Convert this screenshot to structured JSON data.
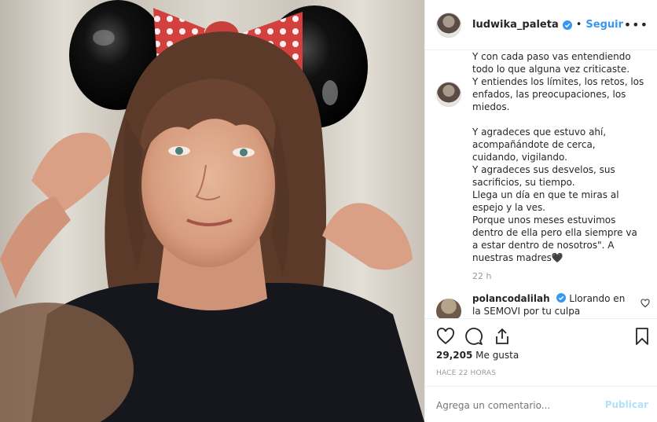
{
  "header": {
    "username": "ludwika_paleta",
    "dot": "•",
    "follow_label": "Seguir",
    "more_icon": "more-horizontal-icon"
  },
  "caption": {
    "lines_a": [
      "Y con cada paso vas entendiendo",
      "todo lo que alguna vez criticaste.",
      "Y entiendes los límites, los retos, los",
      "enfados, las preocupaciones, los",
      "miedos."
    ],
    "lines_b": [
      "Y agradeces que estuvo ahí,",
      "acompañándote de cerca,",
      "cuidando, vigilando.",
      "Y agradeces sus desvelos, sus",
      "sacrificios, su tiempo.",
      "Llega un día en que te miras al",
      "espejo y la ves.",
      "Porque unos meses estuvimos",
      "dentro de ella pero ella siempre va",
      "a estar dentro de nosotros\". A",
      "nuestras madres🖤"
    ],
    "time": "22 h"
  },
  "comment": {
    "username": "polancodalilah",
    "text": "Llorando en la SEMOVI por tu culpa"
  },
  "actions": {
    "like_icon": "heart-icon",
    "comment_icon": "comment-icon",
    "share_icon": "share-icon",
    "save_icon": "bookmark-icon"
  },
  "likes": {
    "count": "29,205",
    "label": "Me gusta"
  },
  "posted_ago": "HACE 22 HORAS",
  "add_comment": {
    "placeholder": "Agrega un comentario...",
    "publish_label": "Publicar"
  },
  "colors": {
    "link": "#3897f0",
    "verified": "#3897f0",
    "publish_disabled": "#b2dffc"
  }
}
